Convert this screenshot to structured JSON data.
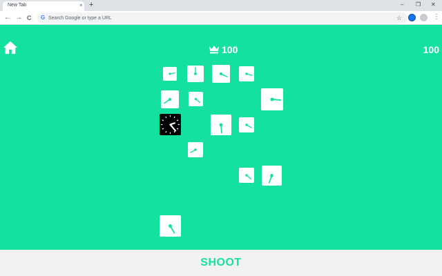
{
  "browser": {
    "tab_title": "New Tab",
    "tab_close_glyph": "×",
    "new_tab_glyph": "+",
    "minimize_glyph": "–",
    "restore_glyph": "❐",
    "close_glyph": "✕",
    "back_glyph": "←",
    "forward_glyph": "→",
    "reload_glyph": "C",
    "omnibox_logo": "G",
    "omnibox_placeholder": "Search Google or type a URL",
    "bookmark_glyph": "☆",
    "menu_glyph": "⋮"
  },
  "game": {
    "background_color": "#14e09f",
    "best_score": "100",
    "score": "100",
    "shoot_label": "SHOOT",
    "icons": [
      "home-icon",
      "crown-icon",
      "clock-tile-icon"
    ],
    "tiles": [
      {
        "type": "dial",
        "angle": 80
      },
      {
        "type": "dial",
        "angle": 0
      },
      {
        "type": "dial",
        "angle": 115
      },
      {
        "type": "dial",
        "angle": 105
      },
      {
        "type": "dial",
        "angle": 235
      },
      {
        "type": "dial",
        "angle": 130
      },
      {
        "type": "dial",
        "angle": 95
      },
      {
        "type": "player",
        "angle": 140
      },
      {
        "type": "dial",
        "angle": 175
      },
      {
        "type": "dial",
        "angle": 120
      },
      {
        "type": "dial",
        "angle": 240
      },
      {
        "type": "dial",
        "angle": 130
      },
      {
        "type": "dial",
        "angle": 200
      },
      {
        "type": "dial",
        "angle": 150
      }
    ]
  }
}
